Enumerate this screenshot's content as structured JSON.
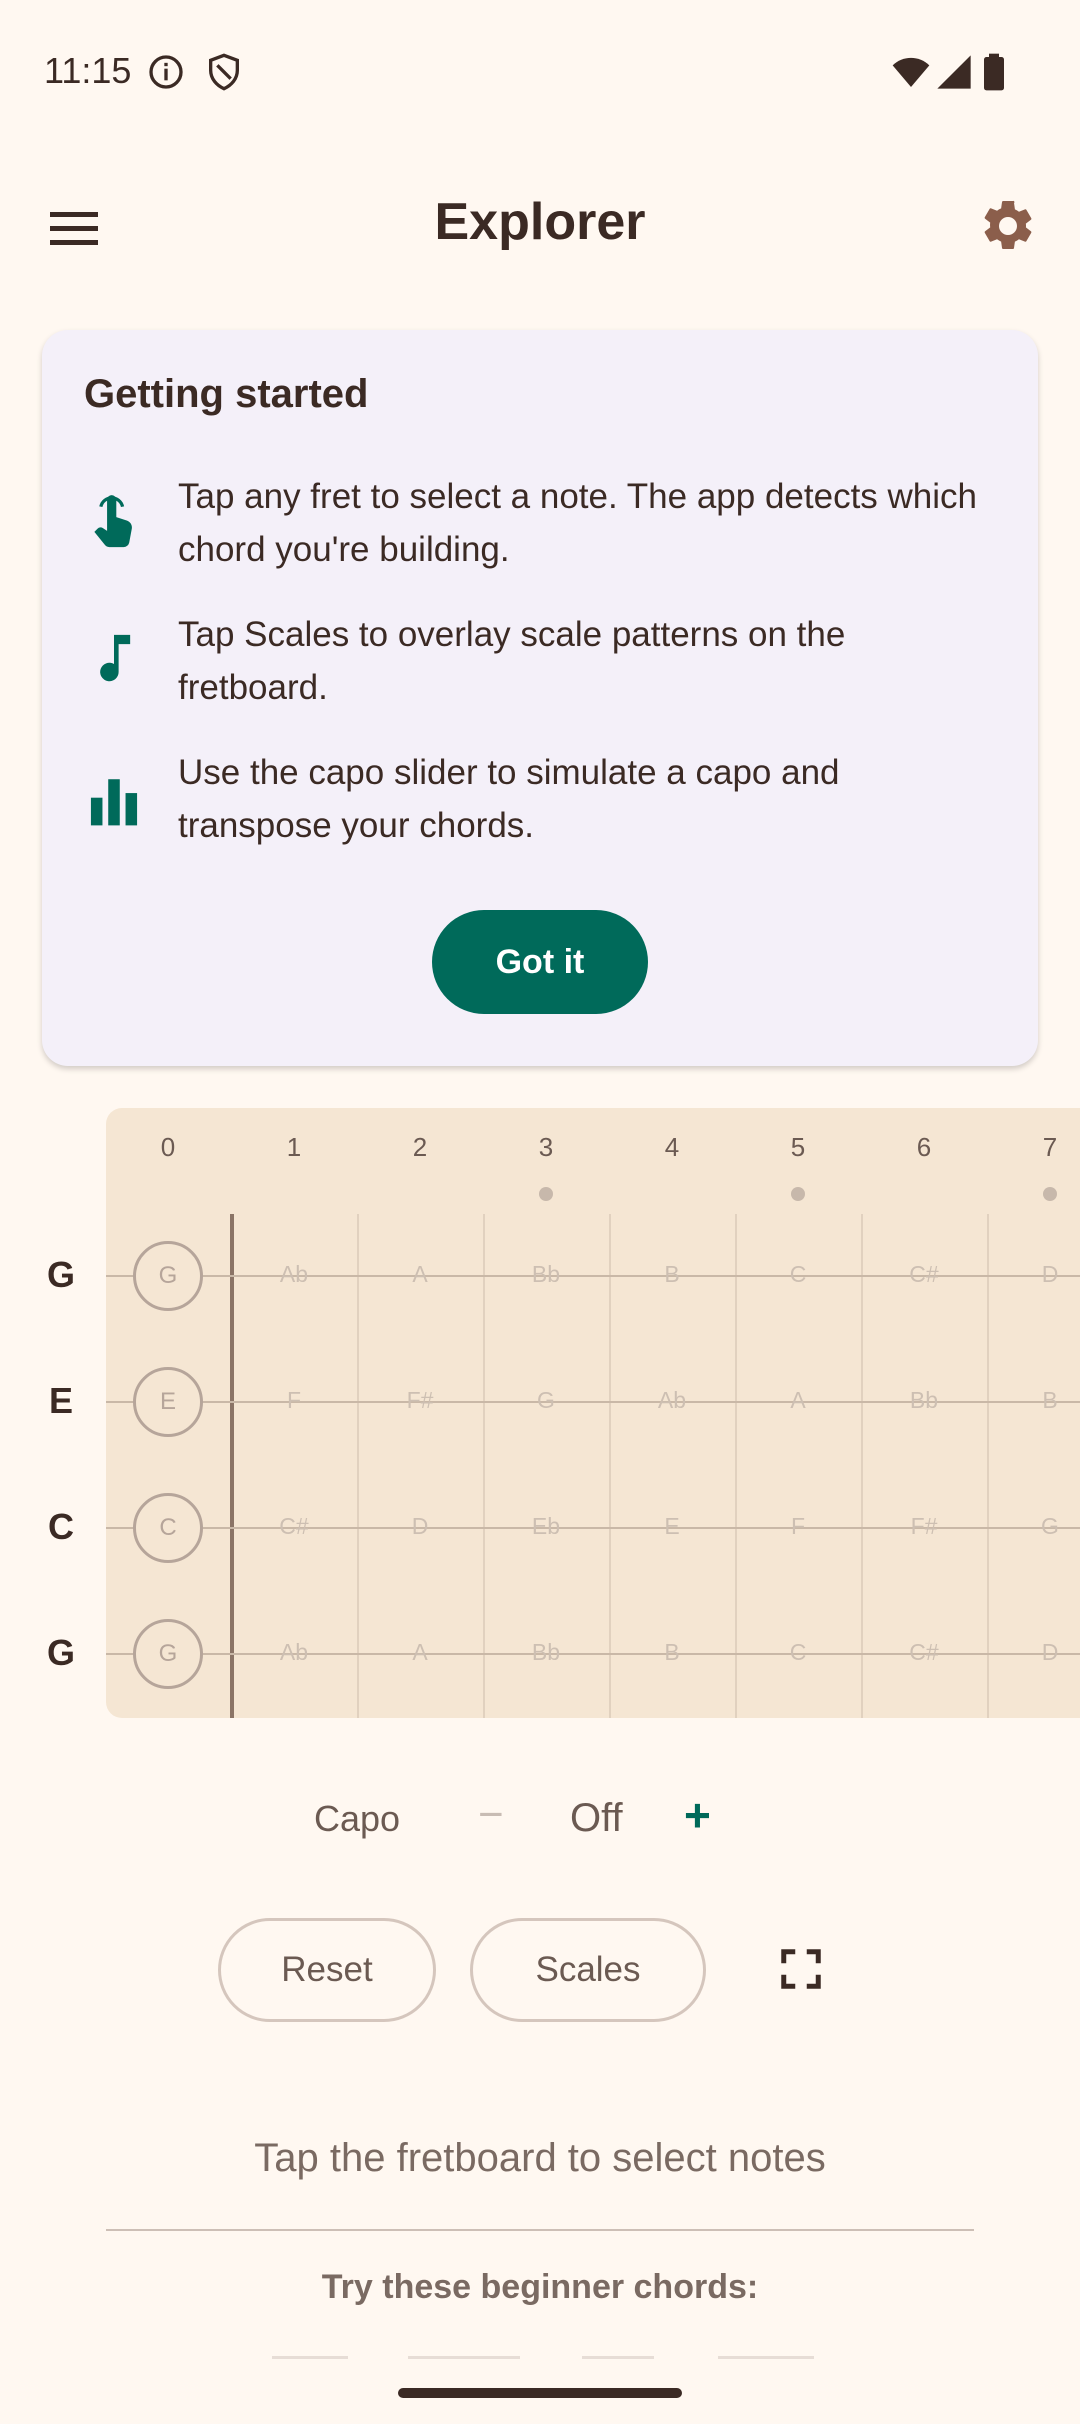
{
  "status": {
    "time": "11:15",
    "icons": [
      "info-icon",
      "shield-icon",
      "wifi-icon",
      "signal-icon",
      "battery-icon"
    ]
  },
  "appbar": {
    "title": "Explorer",
    "menu_icon": "hamburger-menu-icon",
    "settings_icon": "gear-icon"
  },
  "card": {
    "title": "Getting started",
    "tips": [
      {
        "icon": "tap-hand-icon",
        "text": "Tap any fret to select a note. The app detects which chord you're building."
      },
      {
        "icon": "music-note-icon",
        "text": "Tap Scales to overlay scale patterns on the fretboard."
      },
      {
        "icon": "bar-chart-icon",
        "text": "Use the capo slider to simulate a capo and transpose your chords."
      }
    ],
    "button": "Got it"
  },
  "fretboard": {
    "fret_numbers": [
      "0",
      "1",
      "2",
      "3",
      "4",
      "5",
      "6",
      "7"
    ],
    "marker_frets": [
      "3",
      "5",
      "7"
    ],
    "strings": [
      {
        "name": "G",
        "notes": [
          "G",
          "Ab",
          "A",
          "Bb",
          "B",
          "C",
          "C#",
          "D"
        ]
      },
      {
        "name": "E",
        "notes": [
          "E",
          "F",
          "F#",
          "G",
          "Ab",
          "A",
          "Bb",
          "B"
        ]
      },
      {
        "name": "C",
        "notes": [
          "C",
          "C#",
          "D",
          "Eb",
          "E",
          "F",
          "F#",
          "G"
        ]
      },
      {
        "name": "G",
        "notes": [
          "G",
          "Ab",
          "A",
          "Bb",
          "B",
          "C",
          "C#",
          "D"
        ]
      }
    ]
  },
  "capo": {
    "label": "Capo",
    "minus": "−",
    "value": "Off",
    "plus": "+"
  },
  "controls": {
    "reset": "Reset",
    "scales": "Scales",
    "fullscreen_icon": "fullscreen-icon"
  },
  "hint": "Tap the fretboard to select notes",
  "beginner": {
    "title": "Try these beginner chords:"
  },
  "colors": {
    "background": "#fff8f1",
    "accent": "#006a5a",
    "fretboard": "#f5e6d3",
    "card": "#f4f0f9"
  }
}
